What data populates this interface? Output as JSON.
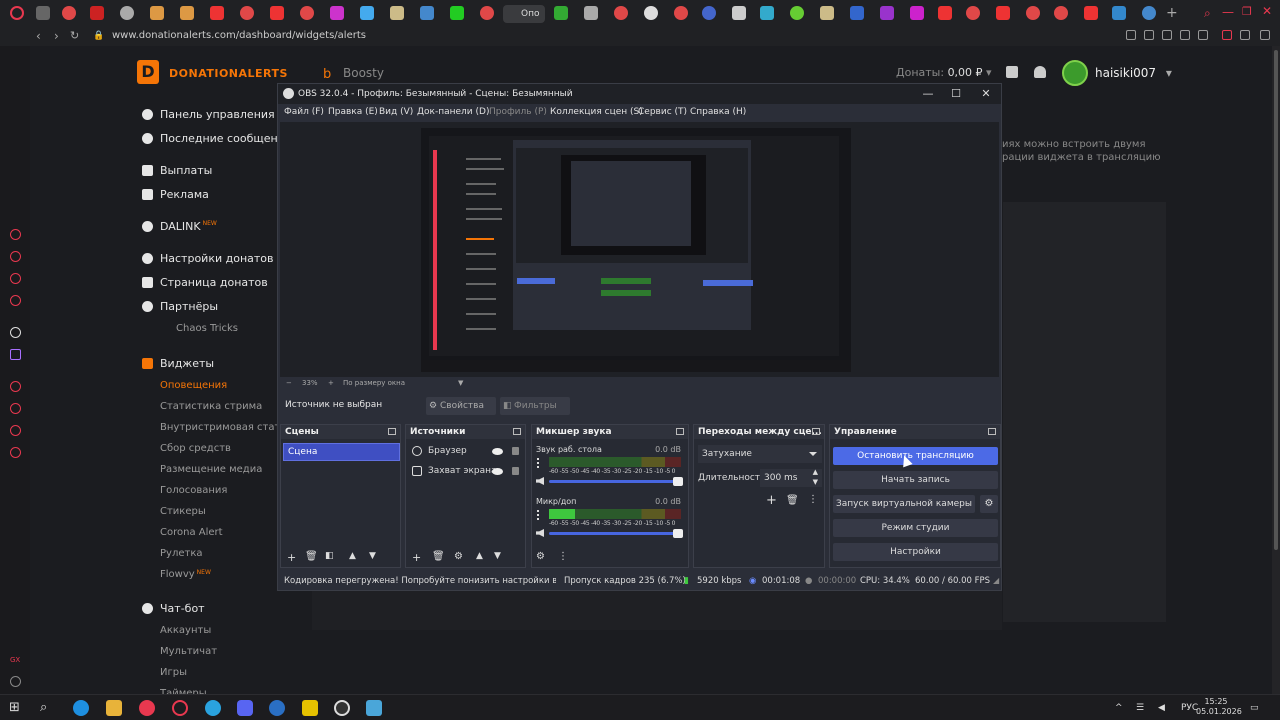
{
  "browser": {
    "active_tab_label": "Опо",
    "url": "www.donationalerts.com/dashboard/widgets/alerts"
  },
  "site": {
    "logo_text": "DONATIONALERTS",
    "boosty_label": "Boosty",
    "donates_label": "Донаты:",
    "donates_value": "0,00 ₽",
    "username": "haisiki007",
    "menu": [
      {
        "label": "Панель управления"
      },
      {
        "label": "Последние сообщения"
      },
      {
        "label": "Выплаты"
      },
      {
        "label": "Реклама"
      },
      {
        "label": "DALINK",
        "badge": "NEW"
      },
      {
        "label": "Настройки донатов"
      },
      {
        "label": "Страница донатов"
      },
      {
        "label": "Партнёры"
      },
      {
        "label": "Виджеты"
      },
      {
        "label": "Чат-бот"
      }
    ],
    "partners_sub": "Chaos Tricks",
    "widget_subs": [
      "Оповещения",
      "Статистика стрима",
      "Внутристримовая статистика",
      "Сбор средств",
      "Размещение медиа",
      "Голосования",
      "Стикеры",
      "Corona Alert",
      "Рулетка",
      "Flowvy"
    ],
    "flowvy_badge": "NEW",
    "chatbot_subs": [
      "Аккаунты",
      "Мультичат",
      "Игры",
      "Таймеры"
    ],
    "right_line1": "иях можно встроить двумя",
    "right_line2": "рации виджета в трансляцию"
  },
  "obs": {
    "title": "OBS 32.0.4 - Профиль: Безымянный - Сцены: Безымянный",
    "window_minimize": "—",
    "window_maximize": "☐",
    "window_close": "✕",
    "menu": [
      "Файл (F)",
      "Правка (E)",
      "Вид (V)",
      "Док-панели (D)",
      "Профиль (P)",
      "Коллекция сцен (S)",
      "Сервис (T)",
      "Справка (H)"
    ],
    "zoom": "33%",
    "zoom_mode": "По размеру окна",
    "no_source": "Источник не выбран",
    "properties_btn": "Свойства",
    "filters_btn": "Фильтры",
    "scenes": {
      "title": "Сцены",
      "items": [
        "Сцена"
      ]
    },
    "sources": {
      "title": "Источники",
      "items": [
        "Браузер",
        "Захват экрана"
      ]
    },
    "mixer": {
      "title": "Микшер звука",
      "channels": [
        {
          "name": "Звук раб. стола",
          "db": "0.0 dB",
          "level": 0.0
        },
        {
          "name": "Микр/доп",
          "db": "0.0 dB",
          "level": 0.2
        }
      ],
      "scale": "-60 -55 -50 -45 -40 -35 -30 -25 -20 -15 -10 -5 0"
    },
    "transitions": {
      "title": "Переходы между сце...",
      "selected": "Затухание",
      "duration_label": "Длительность",
      "duration_value": "300 ms"
    },
    "controls": {
      "title": "Управление",
      "buttons": [
        "Остановить трансляцию",
        "Начать запись",
        "Запуск виртуальной камеры",
        "Режим студии",
        "Настройки"
      ]
    },
    "status": {
      "warning": "Кодировка перегружена! Попробуйте понизить настройки видео",
      "dropped": "Пропуск кадров 235 (6.7%)",
      "bitrate": "5920 kbps",
      "stream_time": "00:01:08",
      "rec_time": "00:00:00",
      "cpu": "CPU: 34.4%",
      "fps": "60.00 / 60.00 FPS"
    }
  },
  "taskbar": {
    "lang": "РУС",
    "time": "15:25",
    "date": "05.01.2026"
  }
}
